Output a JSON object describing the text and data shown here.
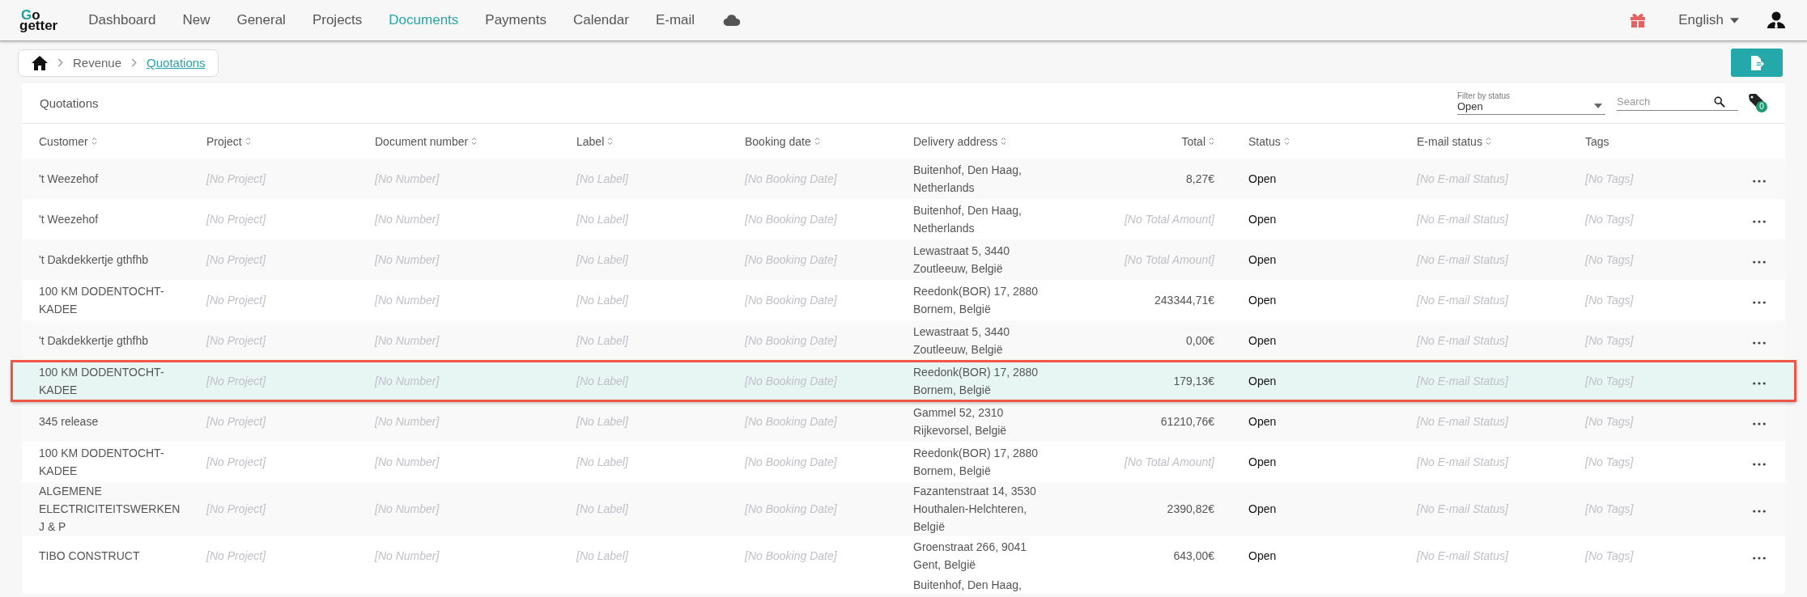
{
  "nav": {
    "logo_top": "Go",
    "logo_bottom": "getter",
    "items": [
      {
        "label": "Dashboard",
        "selected": false
      },
      {
        "label": "New",
        "selected": false
      },
      {
        "label": "General",
        "selected": false
      },
      {
        "label": "Projects",
        "selected": false
      },
      {
        "label": "Documents",
        "selected": true
      },
      {
        "label": "Payments",
        "selected": false
      },
      {
        "label": "Calendar",
        "selected": false
      },
      {
        "label": "E-mail",
        "selected": false
      }
    ],
    "language": "English"
  },
  "breadcrumb": [
    "Revenue",
    "Quotations"
  ],
  "card": {
    "title": "Quotations",
    "filter": {
      "label": "Filter by status",
      "value": "Open"
    },
    "search": {
      "placeholder": "Search"
    },
    "tag_count": "0"
  },
  "columns": [
    {
      "label": "Customer",
      "sortable": true
    },
    {
      "label": "Project",
      "sortable": true
    },
    {
      "label": "Document number",
      "sortable": true
    },
    {
      "label": "Label",
      "sortable": true
    },
    {
      "label": "Booking date",
      "sortable": true
    },
    {
      "label": "Delivery address",
      "sortable": true
    },
    {
      "label": "Total",
      "sortable": true
    },
    {
      "label": "Status",
      "sortable": true
    },
    {
      "label": "E-mail status",
      "sortable": true
    },
    {
      "label": "Tags",
      "sortable": false
    }
  ],
  "rows": [
    {
      "selected": false,
      "customer": "'t Weezehof",
      "project": "[No Project]",
      "number": "[No Number]",
      "label": "[No Label]",
      "booking_date": "[No Booking Date]",
      "address": "Buitenhof, Den Haag, Netherlands",
      "total": {
        "text": "8,27€",
        "missing": false
      },
      "status": "Open",
      "email_status": "[No E-mail Status]",
      "tags": "[No Tags]"
    },
    {
      "selected": false,
      "customer": "'t Weezehof",
      "project": "[No Project]",
      "number": "[No Number]",
      "label": "[No Label]",
      "booking_date": "[No Booking Date]",
      "address": "Buitenhof, Den Haag, Netherlands",
      "total": {
        "text": "[No Total Amount]",
        "missing": true
      },
      "status": "Open",
      "email_status": "[No E-mail Status]",
      "tags": "[No Tags]"
    },
    {
      "selected": false,
      "customer": "'t Dakdekkertje gthfhb",
      "project": "[No Project]",
      "number": "[No Number]",
      "label": "[No Label]",
      "booking_date": "[No Booking Date]",
      "address": "Lewastraat 5, 3440 Zoutleeuw, België",
      "total": {
        "text": "[No Total Amount]",
        "missing": true
      },
      "status": "Open",
      "email_status": "[No E-mail Status]",
      "tags": "[No Tags]"
    },
    {
      "selected": false,
      "customer": "100 KM DODENTOCHT-KADEE",
      "project": "[No Project]",
      "number": "[No Number]",
      "label": "[No Label]",
      "booking_date": "[No Booking Date]",
      "address": "Reedonk(BOR) 17, 2880 Bornem, België",
      "total": {
        "text": "243344,71€",
        "missing": false
      },
      "status": "Open",
      "email_status": "[No E-mail Status]",
      "tags": "[No Tags]"
    },
    {
      "selected": false,
      "customer": "'t Dakdekkertje gthfhb",
      "project": "[No Project]",
      "number": "[No Number]",
      "label": "[No Label]",
      "booking_date": "[No Booking Date]",
      "address": "Lewastraat 5, 3440 Zoutleeuw, België",
      "total": {
        "text": "0,00€",
        "missing": false
      },
      "status": "Open",
      "email_status": "[No E-mail Status]",
      "tags": "[No Tags]"
    },
    {
      "selected": true,
      "customer": "100 KM DODENTOCHT-KADEE",
      "project": "[No Project]",
      "number": "[No Number]",
      "label": "[No Label]",
      "booking_date": "[No Booking Date]",
      "address": "Reedonk(BOR) 17, 2880 Bornem, België",
      "total": {
        "text": "179,13€",
        "missing": false
      },
      "status": "Open",
      "email_status": "[No E-mail Status]",
      "tags": "[No Tags]"
    },
    {
      "selected": false,
      "customer": "345 release",
      "project": "[No Project]",
      "number": "[No Number]",
      "label": "[No Label]",
      "booking_date": "[No Booking Date]",
      "address": "Gammel 52, 2310 Rijkevorsel, België",
      "total": {
        "text": "61210,76€",
        "missing": false
      },
      "status": "Open",
      "email_status": "[No E-mail Status]",
      "tags": "[No Tags]"
    },
    {
      "selected": false,
      "customer": "100 KM DODENTOCHT-KADEE",
      "project": "[No Project]",
      "number": "[No Number]",
      "label": "[No Label]",
      "booking_date": "[No Booking Date]",
      "address": "Reedonk(BOR) 17, 2880 Bornem, België",
      "total": {
        "text": "[No Total Amount]",
        "missing": true
      },
      "status": "Open",
      "email_status": "[No E-mail Status]",
      "tags": "[No Tags]"
    },
    {
      "selected": false,
      "customer": "ALGEMENE ELECTRICITEITSWERKEN J & P",
      "project": "[No Project]",
      "number": "[No Number]",
      "label": "[No Label]",
      "booking_date": "[No Booking Date]",
      "address": "Fazantenstraat 14, 3530 Houthalen-Helchteren, België",
      "total": {
        "text": "2390,82€",
        "missing": false
      },
      "status": "Open",
      "email_status": "[No E-mail Status]",
      "tags": "[No Tags]"
    },
    {
      "selected": false,
      "customer": "TIBO CONSTRUCT",
      "project": "[No Project]",
      "number": "[No Number]",
      "label": "[No Label]",
      "booking_date": "[No Booking Date]",
      "address": "Groenstraat 266, 9041 Gent, België",
      "total": {
        "text": "643,00€",
        "missing": false
      },
      "status": "Open",
      "email_status": "[No E-mail Status]",
      "tags": "[No Tags]"
    }
  ],
  "partial_row": {
    "address": "Buitenhof, Den Haag,"
  }
}
